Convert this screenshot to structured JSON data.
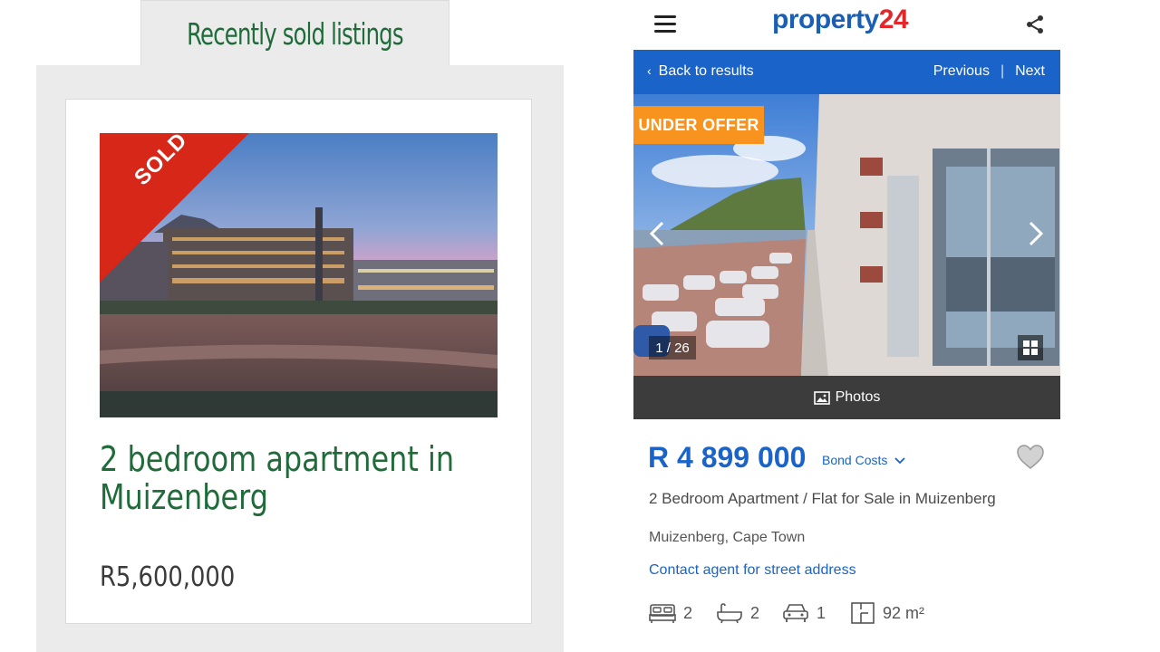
{
  "left": {
    "tab_title": "Recently sold listings",
    "sold_label": "SOLD",
    "listing_title": "2 bedroom apartment in Muizenberg",
    "listing_price": "R5,600,000"
  },
  "right": {
    "logo": {
      "part1": "property",
      "part2": "24"
    },
    "nav": {
      "back": "Back to results",
      "previous": "Previous",
      "next": "Next"
    },
    "gallery": {
      "badge": "UNDER OFFER",
      "counter": "1 / 26",
      "photos_label": "Photos"
    },
    "listing": {
      "price": "R 4 899 000",
      "bond_costs": "Bond Costs",
      "title": "2 Bedroom Apartment / Flat for Sale in Muizenberg",
      "location": "Muizenberg, Cape Town",
      "contact": "Contact agent for street address"
    },
    "features": {
      "bedrooms": "2",
      "bathrooms": "2",
      "parking": "1",
      "floor_size": "92 m²"
    }
  },
  "colors": {
    "brand_green": "#1f6b3a",
    "brand_blue": "#1a63c8",
    "logo_red": "#e2262a",
    "badge_orange": "#f7931e",
    "sold_red": "#d62718"
  },
  "icons": [
    "hamburger-icon",
    "share-icon",
    "chevron-left-icon",
    "chevron-right-icon",
    "grid-icon",
    "image-icon",
    "chevron-down-icon",
    "heart-icon",
    "bed-icon",
    "bath-icon",
    "car-icon",
    "floorplan-icon"
  ]
}
